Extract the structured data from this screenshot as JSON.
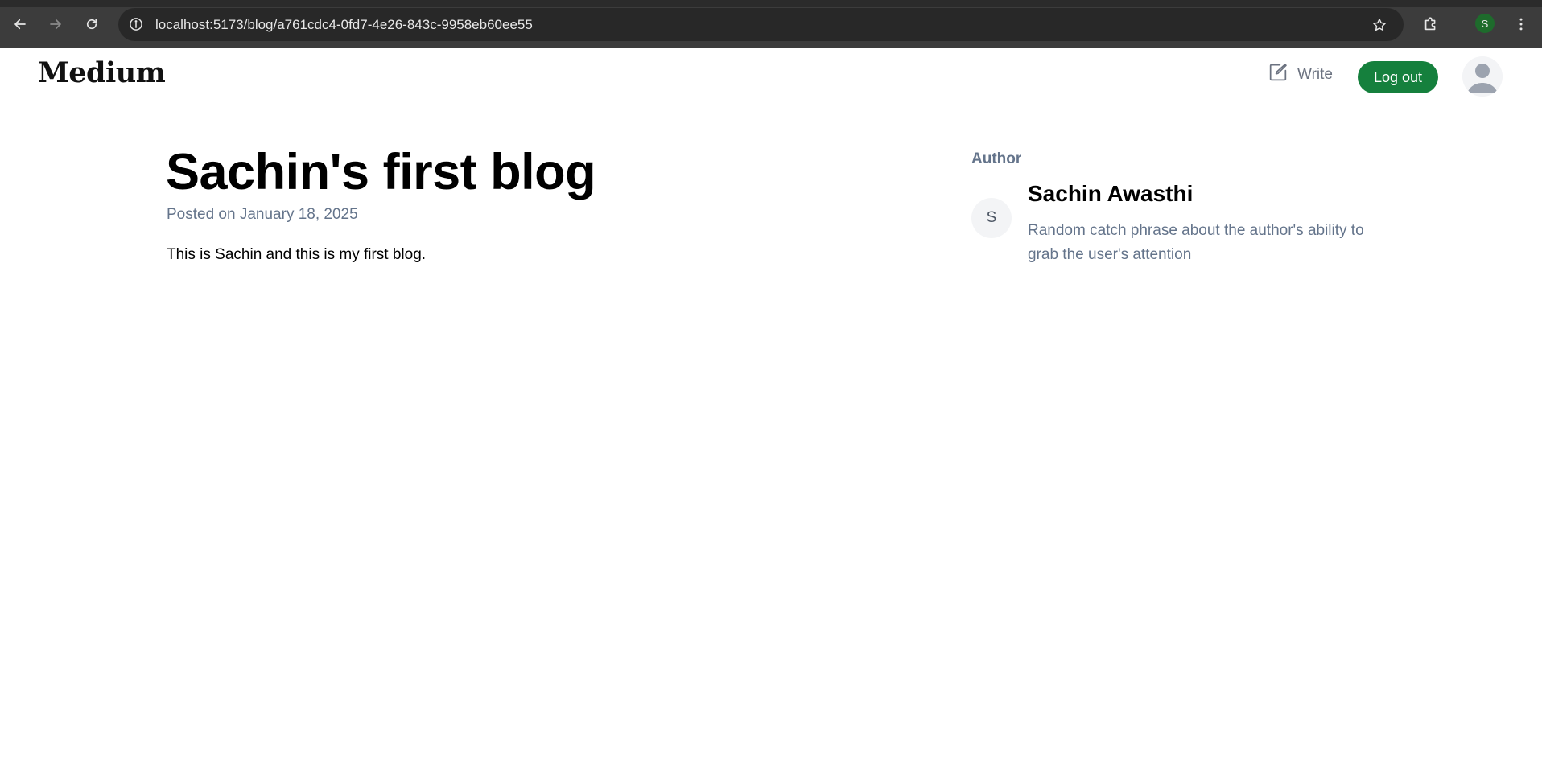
{
  "browser": {
    "url": "localhost:5173/blog/a761cdc4-0fd7-4e26-843c-9958eb60ee55",
    "profile_initial": "S",
    "icons": {
      "back": "back-arrow-icon",
      "forward": "forward-arrow-icon",
      "reload": "reload-icon",
      "site_info": "info-icon",
      "bookmark": "star-icon",
      "extensions": "puzzle-icon",
      "menu": "kebab-menu-icon"
    }
  },
  "header": {
    "logo": "Medium",
    "write_label": "Write",
    "logout_label": "Log out",
    "accent_color": "#15803d"
  },
  "post": {
    "title": "Sachin's first blog",
    "date": "Posted on January 18, 2025",
    "body": "This is Sachin and this is my first blog."
  },
  "author": {
    "section_label": "Author",
    "initial": "S",
    "name": "Sachin Awasthi",
    "bio": "Random catch phrase about the author's ability to grab the user's attention"
  }
}
